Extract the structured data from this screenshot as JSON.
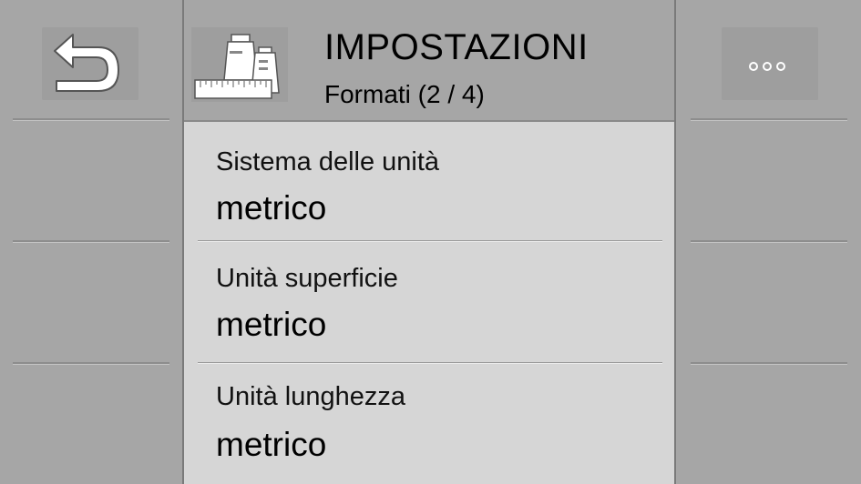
{
  "header": {
    "title": "IMPOSTAZIONI",
    "subtitle": "Formati (2 / 4)",
    "icon": "scale-weights-icon"
  },
  "left_panel": {
    "back_button": {
      "icon": "back-arrow-icon"
    }
  },
  "right_panel": {
    "more_button": {
      "icon": "more-dots-icon"
    }
  },
  "settings": [
    {
      "label": "Sistema delle unità",
      "value": "metrico"
    },
    {
      "label": "Unità superficie",
      "value": "metrico"
    },
    {
      "label": "Unità lunghezza",
      "value": "metrico"
    }
  ],
  "colors": {
    "background": "#a6a6a6",
    "content_bg": "#d6d6d6",
    "text": "#000000"
  }
}
